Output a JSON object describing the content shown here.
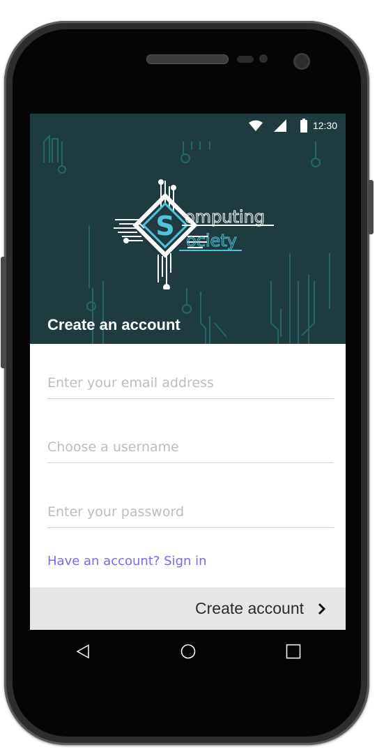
{
  "status_bar": {
    "time": "12:30"
  },
  "logo": {
    "letter": "S",
    "line1": "omputing",
    "line2": "ociety"
  },
  "header": {
    "title": "Create an account"
  },
  "form": {
    "email_placeholder": "Enter your email address",
    "username_placeholder": "Choose a username",
    "password_placeholder": "Enter your password"
  },
  "links": {
    "signin": "Have an account? Sign in"
  },
  "actions": {
    "create_account_label": "Create account"
  },
  "nav": {
    "icons": [
      "back-icon",
      "home-icon",
      "recents-icon"
    ]
  },
  "colors": {
    "header_bg": "#1f3b3f",
    "accent_cyan": "#4fc3d9",
    "link": "#7b68ee",
    "action_bar_bg": "#e6e6e6"
  }
}
